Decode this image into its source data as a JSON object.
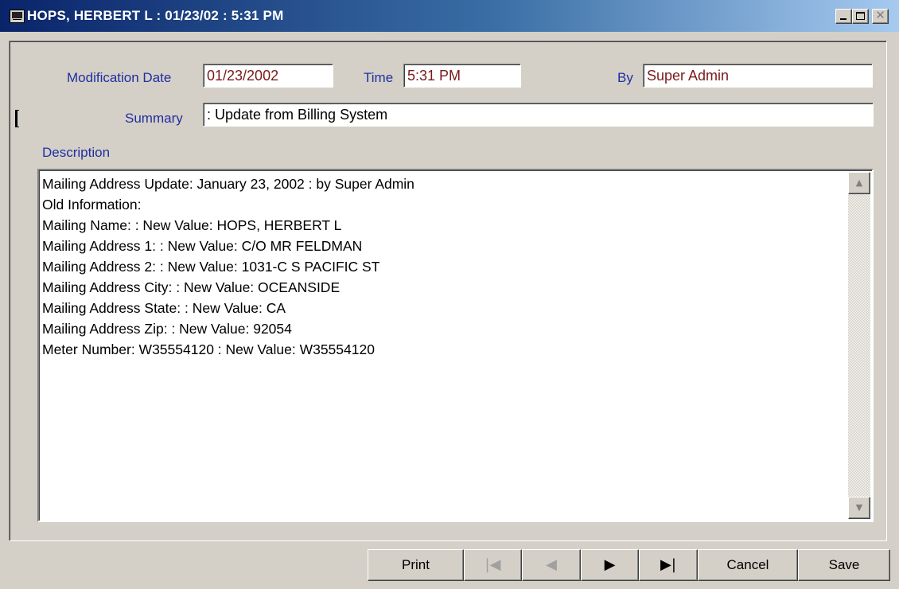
{
  "window": {
    "title": "HOPS, HERBERT L : 01/23/02 : 5:31 PM",
    "icon": "app-icon"
  },
  "form": {
    "modification_date_label": "Modification Date",
    "modification_date_value": "01/23/2002",
    "time_label": "Time",
    "time_value": "5:31 PM",
    "by_label": "By",
    "by_value": "Super Admin",
    "summary_label": "Summary",
    "summary_value": " :  Update from Billing System",
    "description_label": "Description",
    "description_lines": [
      "Mailing Address Update:  January 23, 2002 : by  Super Admin",
      "Old Information:",
      "Mailing Name:   : New Value:  HOPS, HERBERT L",
      "Mailing Address 1:   : New Value:  C/O MR FELDMAN",
      "Mailing Address 2:   : New Value:  1031-C S PACIFIC ST",
      "Mailing Address City:   : New Value:  OCEANSIDE",
      "Mailing Address State:   : New Value:  CA",
      "Mailing Address Zip:   : New Value:  92054",
      "Meter Number:  W35554120  : New Value:  W35554120"
    ]
  },
  "buttons": {
    "print": "Print",
    "first": "|◀",
    "prev": "◀",
    "next": "▶",
    "last": "▶|",
    "cancel": "Cancel",
    "save": "Save"
  },
  "colors": {
    "label_blue": "#1f2fa0",
    "value_red": "#7a1a1a",
    "titlebar_start": "#0a246a",
    "titlebar_end": "#a6caf0"
  }
}
